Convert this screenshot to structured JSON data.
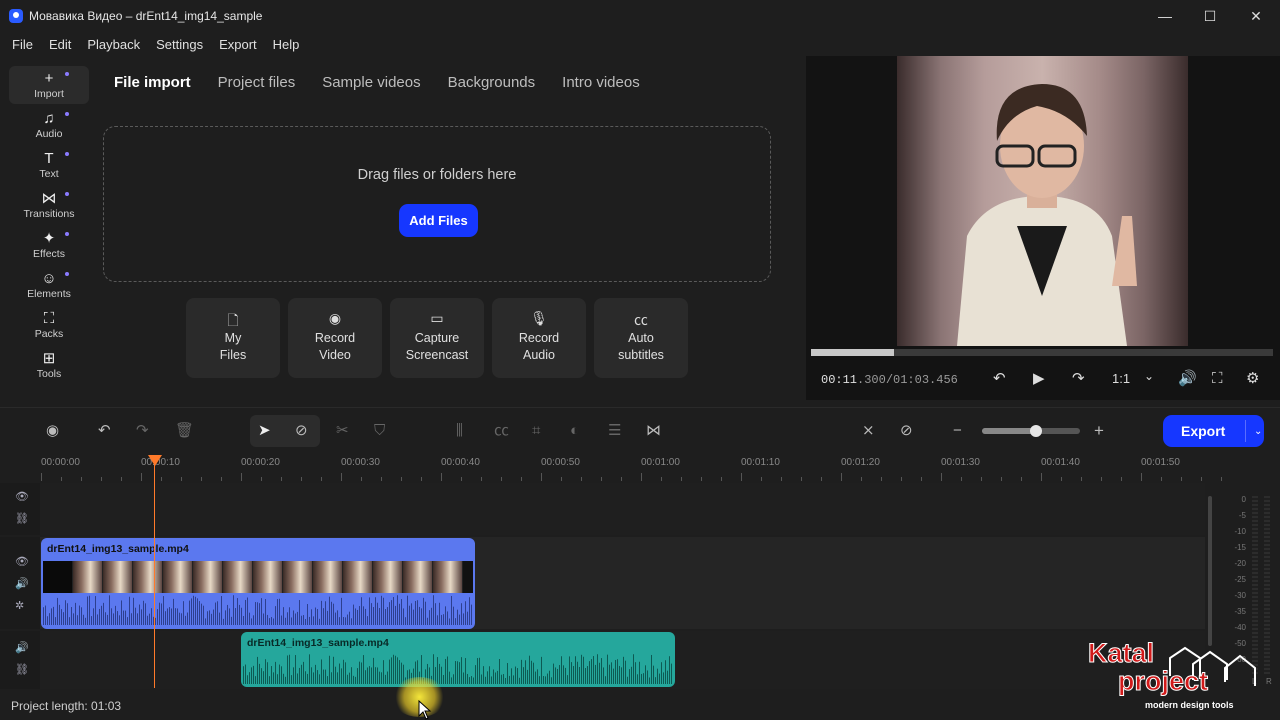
{
  "window": {
    "title": "Мовавика Видео – drEnt14_img14_sample",
    "minimize": "—",
    "maximize": "☐",
    "close": "✕"
  },
  "menu": [
    "File",
    "Edit",
    "Playback",
    "Settings",
    "Export",
    "Help"
  ],
  "sidebar": {
    "items": [
      {
        "label": "Import",
        "icon": "plus-icon",
        "glyph": "+"
      },
      {
        "label": "Audio",
        "icon": "music-note-icon",
        "glyph": "♫"
      },
      {
        "label": "Text",
        "icon": "text-icon",
        "glyph": "T"
      },
      {
        "label": "Transitions",
        "icon": "transitions-icon",
        "glyph": "⋈"
      },
      {
        "label": "Effects",
        "icon": "sparkle-icon",
        "glyph": "✦"
      },
      {
        "label": "Elements",
        "icon": "smiley-icon",
        "glyph": "☺"
      },
      {
        "label": "Packs",
        "icon": "bag-icon",
        "glyph": "⛶"
      },
      {
        "label": "Tools",
        "icon": "grid-icon",
        "glyph": "⊞"
      }
    ]
  },
  "import": {
    "tabs": [
      "File import",
      "Project files",
      "Sample videos",
      "Backgrounds",
      "Intro videos"
    ],
    "drop_text": "Drag files or folders here",
    "add_files": "Add Files",
    "sources": [
      {
        "label": "My\nFiles",
        "icon": "file-icon",
        "glyph": "🗋"
      },
      {
        "label": "Record\nVideo",
        "icon": "webcam-icon",
        "glyph": "◉"
      },
      {
        "label": "Capture\nScreencast",
        "icon": "monitor-icon",
        "glyph": "▭"
      },
      {
        "label": "Record\nAudio",
        "icon": "microphone-icon",
        "glyph": "🎙"
      },
      {
        "label": "Auto\nsubtitles",
        "icon": "cc-icon",
        "glyph": "㏄"
      }
    ]
  },
  "player": {
    "time_current_bright": "00:11",
    "time_current_dim": ".300",
    "time_total": "/01:03.456",
    "progress": 0.18,
    "aspect": "1:1",
    "controls": {
      "undo": "↶",
      "play": "▶",
      "redo": "↷",
      "chevron": "⌄",
      "volume": "🔊",
      "fullscreen": "⛶",
      "settings": "⚙"
    }
  },
  "toolbar": {
    "export_label": "Export",
    "export_arrow": "⌄",
    "zoom_level": 0.55
  },
  "timeline": {
    "ticks": [
      "00:00:00",
      "00:00:10",
      "00:00:20",
      "00:00:30",
      "00:00:40",
      "00:00:50",
      "00:01:00",
      "00:01:10",
      "00:01:20",
      "00:01:30",
      "00:01:40",
      "00:01:50"
    ],
    "video_clip_name": "drEnt14_img13_sample.mp4",
    "audio_clip_name": "drEnt14_img13_sample.mp4"
  },
  "meter": {
    "labels": [
      "0",
      "-5",
      "-10",
      "-15",
      "-20",
      "-25",
      "-30",
      "-35",
      "-40",
      "-50",
      "-60"
    ],
    "left": "L",
    "right": "R"
  },
  "status": {
    "project_length": "Project length: 01:03"
  },
  "watermark": {
    "line1": "Katal",
    "line2": "project",
    "tagline": "modern design tools"
  },
  "colors": {
    "accent": "#1637ff",
    "video_clip": "#5b78ef",
    "audio_clip": "#25a79c",
    "playhead": "#ff7a2a"
  }
}
